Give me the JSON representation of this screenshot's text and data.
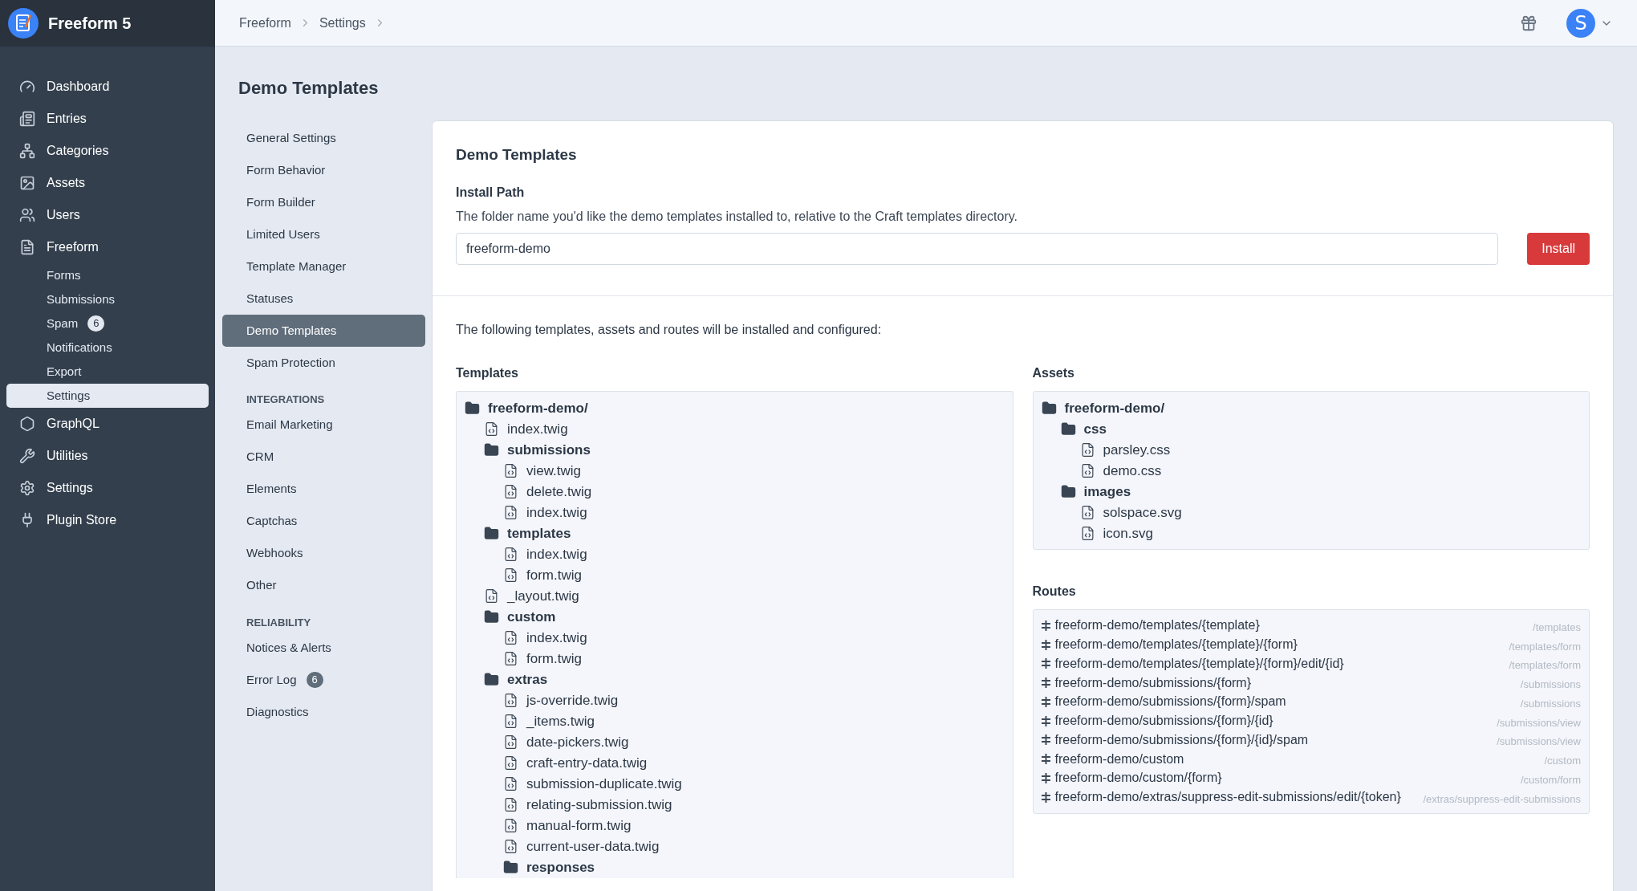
{
  "app": {
    "name": "Freeform 5"
  },
  "nav": [
    {
      "label": "Dashboard",
      "selected": false
    },
    {
      "label": "Entries",
      "selected": false
    },
    {
      "label": "Categories",
      "selected": false
    },
    {
      "label": "Assets",
      "selected": false
    },
    {
      "label": "Users",
      "selected": false
    },
    {
      "label": "Freeform",
      "selected": false,
      "children": [
        {
          "label": "Forms",
          "selected": false
        },
        {
          "label": "Submissions",
          "selected": false
        },
        {
          "label": "Spam",
          "selected": false,
          "badge": "6"
        },
        {
          "label": "Notifications",
          "selected": false
        },
        {
          "label": "Export",
          "selected": false
        },
        {
          "label": "Settings",
          "selected": true
        }
      ]
    },
    {
      "label": "GraphQL",
      "selected": false
    },
    {
      "label": "Utilities",
      "selected": false
    },
    {
      "label": "Settings",
      "selected": false
    },
    {
      "label": "Plugin Store",
      "selected": false
    }
  ],
  "breadcrumbs": [
    "Freeform",
    "Settings"
  ],
  "user": {
    "initial": "S"
  },
  "page_title": "Demo Templates",
  "settings_nav": [
    {
      "kind": "item",
      "label": "General Settings",
      "selected": false
    },
    {
      "kind": "item",
      "label": "Form Behavior",
      "selected": false
    },
    {
      "kind": "item",
      "label": "Form Builder",
      "selected": false
    },
    {
      "kind": "item",
      "label": "Limited Users",
      "selected": false
    },
    {
      "kind": "item",
      "label": "Template Manager",
      "selected": false
    },
    {
      "kind": "item",
      "label": "Statuses",
      "selected": false
    },
    {
      "kind": "item",
      "label": "Demo Templates",
      "selected": true
    },
    {
      "kind": "item",
      "label": "Spam Protection",
      "selected": false
    },
    {
      "kind": "heading",
      "label": "INTEGRATIONS"
    },
    {
      "kind": "item",
      "label": "Email Marketing",
      "selected": false
    },
    {
      "kind": "item",
      "label": "CRM",
      "selected": false
    },
    {
      "kind": "item",
      "label": "Elements",
      "selected": false
    },
    {
      "kind": "item",
      "label": "Captchas",
      "selected": false
    },
    {
      "kind": "item",
      "label": "Webhooks",
      "selected": false
    },
    {
      "kind": "item",
      "label": "Other",
      "selected": false
    },
    {
      "kind": "heading",
      "label": "RELIABILITY"
    },
    {
      "kind": "item",
      "label": "Notices & Alerts",
      "selected": false
    },
    {
      "kind": "item",
      "label": "Error Log",
      "selected": false,
      "badge": "6"
    },
    {
      "kind": "item",
      "label": "Diagnostics",
      "selected": false
    }
  ],
  "card": {
    "title": "Demo Templates",
    "install_path": {
      "label": "Install Path",
      "description": "The folder name you'd like the demo templates installed to, relative to the Craft templates directory.",
      "value": "freeform-demo"
    },
    "install_button": "Install",
    "intro": "The following templates, assets and routes will be installed and configured:",
    "templates": {
      "heading": "Templates",
      "tree": [
        {
          "kind": "folder",
          "name": "freeform-demo/",
          "children": [
            {
              "kind": "file",
              "name": "index.twig"
            },
            {
              "kind": "folder",
              "name": "submissions",
              "children": [
                {
                  "kind": "file",
                  "name": "view.twig"
                },
                {
                  "kind": "file",
                  "name": "delete.twig"
                },
                {
                  "kind": "file",
                  "name": "index.twig"
                }
              ]
            },
            {
              "kind": "folder",
              "name": "templates",
              "children": [
                {
                  "kind": "file",
                  "name": "index.twig"
                },
                {
                  "kind": "file",
                  "name": "form.twig"
                }
              ]
            },
            {
              "kind": "file",
              "name": "_layout.twig"
            },
            {
              "kind": "folder",
              "name": "custom",
              "children": [
                {
                  "kind": "file",
                  "name": "index.twig"
                },
                {
                  "kind": "file",
                  "name": "form.twig"
                }
              ]
            },
            {
              "kind": "folder",
              "name": "extras",
              "children": [
                {
                  "kind": "file",
                  "name": "js-override.twig"
                },
                {
                  "kind": "file",
                  "name": "_items.twig"
                },
                {
                  "kind": "file",
                  "name": "date-pickers.twig"
                },
                {
                  "kind": "file",
                  "name": "craft-entry-data.twig"
                },
                {
                  "kind": "file",
                  "name": "submission-duplicate.twig"
                },
                {
                  "kind": "file",
                  "name": "relating-submission.twig"
                },
                {
                  "kind": "file",
                  "name": "manual-form.twig"
                },
                {
                  "kind": "file",
                  "name": "current-user-data.twig"
                },
                {
                  "kind": "folder",
                  "name": "responses"
                }
              ]
            }
          ]
        }
      ]
    },
    "assets": {
      "heading": "Assets",
      "tree": [
        {
          "kind": "folder",
          "name": "freeform-demo/",
          "children": [
            {
              "kind": "folder",
              "name": "css",
              "children": [
                {
                  "kind": "file",
                  "name": "parsley.css"
                },
                {
                  "kind": "file",
                  "name": "demo.css"
                }
              ]
            },
            {
              "kind": "folder",
              "name": "images",
              "children": [
                {
                  "kind": "file",
                  "name": "solspace.svg"
                },
                {
                  "kind": "file",
                  "name": "icon.svg"
                }
              ]
            }
          ]
        }
      ]
    },
    "routes": {
      "heading": "Routes",
      "items": [
        {
          "pattern": "freeform-demo/templates/{template}",
          "template": "/templates"
        },
        {
          "pattern": "freeform-demo/templates/{template}/{form}",
          "template": "/templates/form"
        },
        {
          "pattern": "freeform-demo/templates/{template}/{form}/edit/{id}",
          "template": "/templates/form"
        },
        {
          "pattern": "freeform-demo/submissions/{form}",
          "template": "/submissions"
        },
        {
          "pattern": "freeform-demo/submissions/{form}/spam",
          "template": "/submissions"
        },
        {
          "pattern": "freeform-demo/submissions/{form}/{id}",
          "template": "/submissions/view"
        },
        {
          "pattern": "freeform-demo/submissions/{form}/{id}/spam",
          "template": "/submissions/view"
        },
        {
          "pattern": "freeform-demo/custom",
          "template": "/custom"
        },
        {
          "pattern": "freeform-demo/custom/{form}",
          "template": "/custom/form"
        },
        {
          "pattern": "freeform-demo/extras/suppress-edit-submissions/edit/{token}",
          "template": "/extras/suppress-edit-submissions"
        }
      ]
    }
  }
}
